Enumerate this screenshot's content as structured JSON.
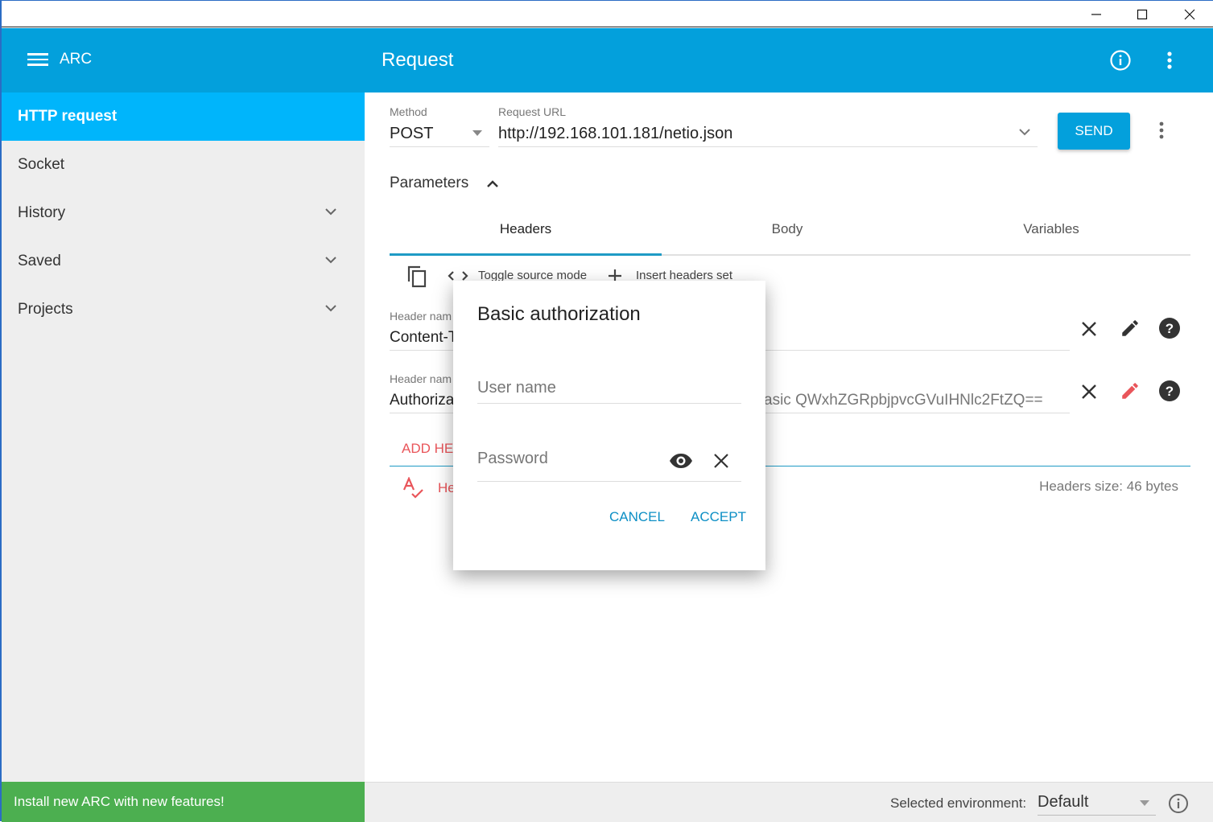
{
  "window": {
    "controls": [
      "minimize",
      "maximize",
      "close"
    ]
  },
  "appbar": {
    "brand": "ARC",
    "title": "Request",
    "icons": [
      "menu-icon",
      "info-icon",
      "more-vert-icon"
    ]
  },
  "sidebar": {
    "items": [
      {
        "label": "HTTP request",
        "active": true,
        "expandable": false
      },
      {
        "label": "Socket",
        "active": false,
        "expandable": false
      },
      {
        "label": "History",
        "active": false,
        "expandable": true
      },
      {
        "label": "Saved",
        "active": false,
        "expandable": true
      },
      {
        "label": "Projects",
        "active": false,
        "expandable": true
      }
    ],
    "promo": "Install new ARC with new features!"
  },
  "request": {
    "method_label": "Method",
    "method": "POST",
    "url_label": "Request URL",
    "url": "http://192.168.101.181/netio.json",
    "send_label": "SEND"
  },
  "parameters": {
    "label": "Parameters",
    "tabs": [
      {
        "label": "Headers",
        "active": true
      },
      {
        "label": "Body",
        "active": false
      },
      {
        "label": "Variables",
        "active": false
      }
    ],
    "toolbar": {
      "toggle_source": "Toggle source mode",
      "insert_set": "Insert headers set"
    },
    "headers": [
      {
        "name_label": "Header nam",
        "name": "Content-T",
        "value": ""
      },
      {
        "name_label": "Header nam",
        "name": "Authoriza",
        "value": "asic QWxhZGRpbjpvcGVuIHNlc2FtZQ=="
      }
    ],
    "add_header": "ADD HEA",
    "validation_text": "He",
    "headers_size": "Headers size: 46 bytes"
  },
  "footer": {
    "env_label": "Selected environment:",
    "env_value": "Default"
  },
  "dialog": {
    "title": "Basic authorization",
    "username_placeholder": "User name",
    "password_placeholder": "Password",
    "cancel": "CANCEL",
    "accept": "ACCEPT"
  },
  "colors": {
    "primary": "#03a0dc",
    "active_nav": "#00b5fb",
    "promo": "#4caf50",
    "accent_red": "#e9555a",
    "dialog_button": "#0d8fc5"
  }
}
